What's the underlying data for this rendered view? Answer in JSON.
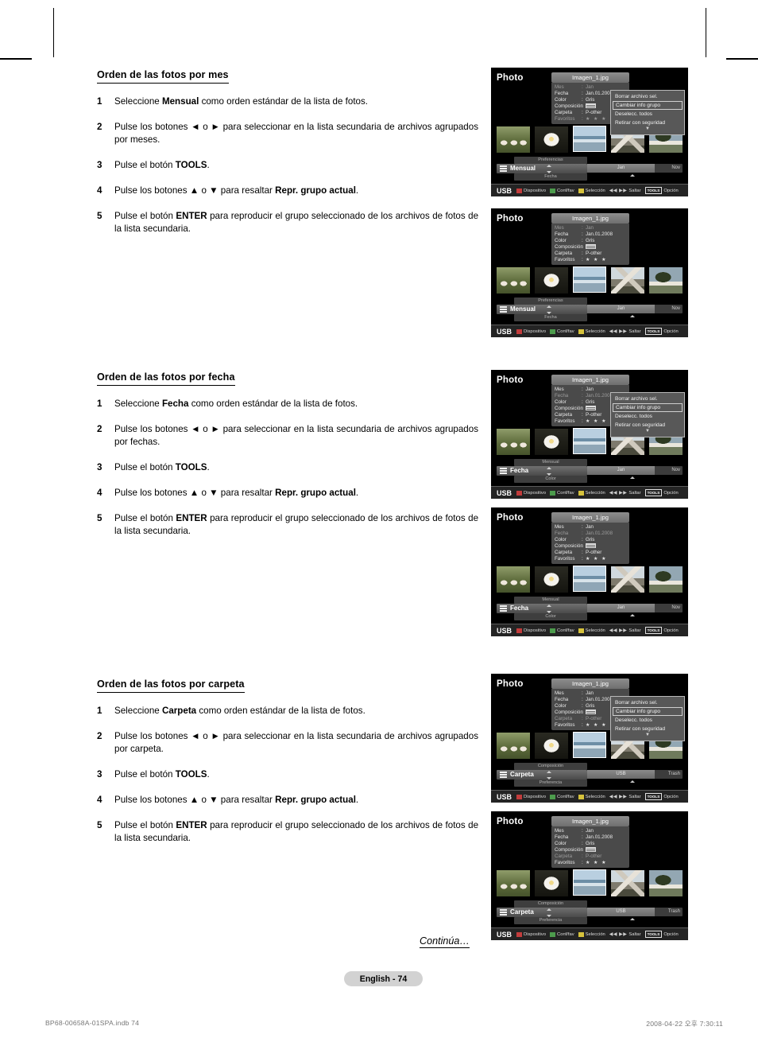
{
  "page": {
    "continue_label": "Continúa…",
    "page_pill": "English - 74",
    "footer_left": "BP68-00658A-01SPA.indb   74",
    "footer_right": "2008-04-22   오후 7:30:11"
  },
  "sections": [
    {
      "title": "Orden de las fotos por mes",
      "steps": [
        {
          "num": "1",
          "parts": [
            {
              "t": "Seleccione "
            },
            {
              "t": "Mensual",
              "b": true
            },
            {
              "t": " como orden estándar de la lista de fotos."
            }
          ]
        },
        {
          "num": "2",
          "parts": [
            {
              "t": "Pulse los botones ◄ o ► para seleccionar en la lista secundaria de archivos agrupados por meses."
            }
          ]
        },
        {
          "num": "3",
          "parts": [
            {
              "t": "Pulse el botón "
            },
            {
              "t": "TOOLS",
              "b": true
            },
            {
              "t": "."
            }
          ]
        },
        {
          "num": "4",
          "parts": [
            {
              "t": "Pulse los botones ▲ o ▼ para resaltar "
            },
            {
              "t": "Repr. grupo actual",
              "b": true
            },
            {
              "t": "."
            }
          ]
        },
        {
          "num": "5",
          "parts": [
            {
              "t": "Pulse el botón "
            },
            {
              "t": "ENTER",
              "b": true
            },
            {
              "t": " para reproducir el grupo seleccionado de los archivos de fotos de la lista secundaria."
            }
          ]
        }
      ]
    },
    {
      "title": "Orden de las fotos por fecha",
      "steps": [
        {
          "num": "1",
          "parts": [
            {
              "t": "Seleccione "
            },
            {
              "t": "Fecha",
              "b": true
            },
            {
              "t": " como orden estándar de la lista de fotos."
            }
          ]
        },
        {
          "num": "2",
          "parts": [
            {
              "t": "Pulse los botones ◄ o ► para seleccionar en la lista secundaria de archivos agrupados por fechas."
            }
          ]
        },
        {
          "num": "3",
          "parts": [
            {
              "t": "Pulse el botón "
            },
            {
              "t": "TOOLS",
              "b": true
            },
            {
              "t": "."
            }
          ]
        },
        {
          "num": "4",
          "parts": [
            {
              "t": "Pulse los botones ▲ o ▼ para resaltar "
            },
            {
              "t": "Repr. grupo actual",
              "b": true
            },
            {
              "t": "."
            }
          ]
        },
        {
          "num": "5",
          "parts": [
            {
              "t": "Pulse el botón "
            },
            {
              "t": "ENTER",
              "b": true
            },
            {
              "t": " para reproducir el grupo seleccionado de los archivos de fotos de la lista secundaria."
            }
          ]
        }
      ]
    },
    {
      "title": "Orden de las fotos por carpeta",
      "steps": [
        {
          "num": "1",
          "parts": [
            {
              "t": "Seleccione "
            },
            {
              "t": "Carpeta",
              "b": true
            },
            {
              "t": " como orden estándar de la lista de fotos."
            }
          ]
        },
        {
          "num": "2",
          "parts": [
            {
              "t": "Pulse los botones ◄ o ► para seleccionar en la lista secundaria de archivos agrupados por carpeta."
            }
          ]
        },
        {
          "num": "3",
          "parts": [
            {
              "t": "Pulse el botón "
            },
            {
              "t": "TOOLS",
              "b": true
            },
            {
              "t": "."
            }
          ]
        },
        {
          "num": "4",
          "parts": [
            {
              "t": "Pulse los botones ▲ o ▼ para resaltar "
            },
            {
              "t": "Repr. grupo actual",
              "b": true
            },
            {
              "t": "."
            }
          ]
        },
        {
          "num": "5",
          "parts": [
            {
              "t": "Pulse el botón "
            },
            {
              "t": "ENTER",
              "b": true
            },
            {
              "t": " para reproducir el grupo seleccionado de los archivos de fotos de la lista secundaria."
            }
          ]
        }
      ]
    }
  ],
  "tv_common": {
    "photo_label": "Photo",
    "file_name": "Imagen_1.jpg",
    "info_keys": [
      "Mes",
      "Fecha",
      "Color",
      "Composición",
      "Carpeta",
      "Favoritos"
    ],
    "info_values": [
      "Jan",
      "Jan.01.2008",
      "Gris",
      "",
      "P-other",
      "★ ★ ★"
    ],
    "menu_items": [
      "Borrar archivo sel.",
      "Cambiar info grupo",
      "Deselecc. todos",
      "Retirar con seguridad"
    ],
    "menu_selected_index": 1,
    "legend": {
      "usb": "USB",
      "items": [
        {
          "color": "#c23c3c",
          "label": "Dispositivo"
        },
        {
          "color": "#4d9c4d",
          "label": "Conf/fav"
        },
        {
          "color": "#d6c23c",
          "label": "Selección"
        }
      ],
      "jump_label": "Saltar",
      "tools_key": "TOOLS",
      "option_label": "Opción"
    },
    "thumbnails": [
      "pigs-photo",
      "flower-photo",
      "sea-photo",
      "mountain-photo",
      "tree-photo"
    ],
    "selected_thumbnail_index": 2
  },
  "tv_screens": [
    {
      "id": "mes-with-tools-menu",
      "sort_prev": "Preferencias",
      "sort_current": "Mensual",
      "sort_next": "Fecha",
      "group_label": "Jan",
      "group_end_label": "Nov",
      "menu_visible": true,
      "dim_rows": [
        0,
        5
      ]
    },
    {
      "id": "mes-plain",
      "sort_prev": "Preferencias",
      "sort_current": "Mensual",
      "sort_next": "Fecha",
      "group_label": "Jan",
      "group_end_label": "Nov",
      "menu_visible": false,
      "dim_rows": [
        0
      ]
    },
    {
      "id": "fecha-with-tools-menu",
      "sort_prev": "Mensual",
      "sort_current": "Fecha",
      "sort_next": "Color",
      "group_label": "Jan",
      "group_end_label": "Nov",
      "menu_visible": true,
      "dim_rows": [
        1
      ]
    },
    {
      "id": "fecha-plain",
      "sort_prev": "Mensual",
      "sort_current": "Fecha",
      "sort_next": "Color",
      "group_label": "Jan",
      "group_end_label": "Nov",
      "menu_visible": false,
      "dim_rows": [
        1
      ]
    },
    {
      "id": "carpeta-with-tools-menu",
      "sort_prev": "Composición",
      "sort_current": "Carpeta",
      "sort_next": "Preferencia",
      "group_label": "USB",
      "group_end_label": "Trash",
      "menu_visible": true,
      "dim_rows": [
        4
      ]
    },
    {
      "id": "carpeta-plain",
      "sort_prev": "Composición",
      "sort_current": "Carpeta",
      "sort_next": "Preferencia",
      "group_label": "USB",
      "group_end_label": "Trash",
      "menu_visible": false,
      "dim_rows": [
        4
      ]
    }
  ]
}
